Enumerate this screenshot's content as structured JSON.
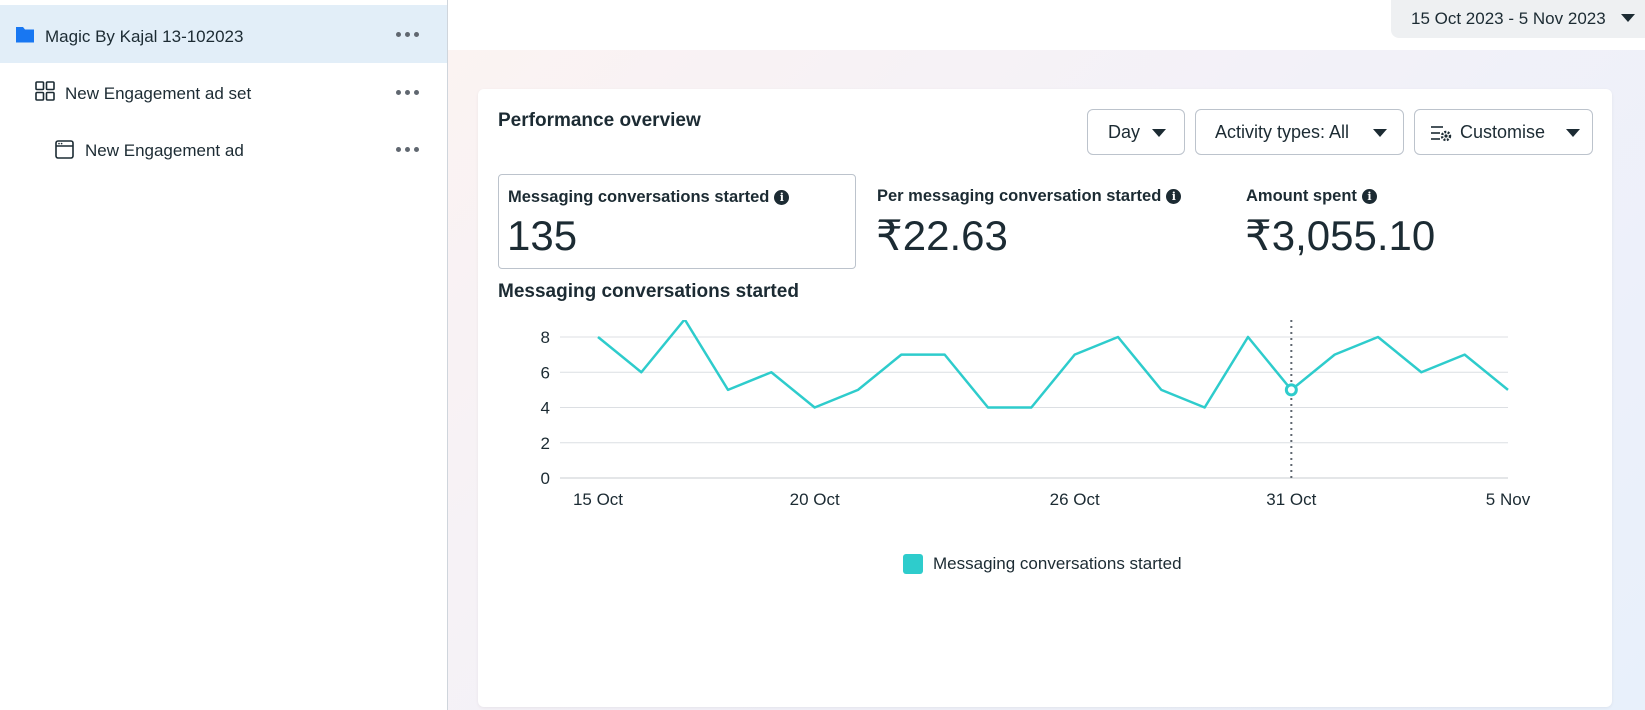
{
  "sidebar": {
    "items": [
      {
        "label": "Magic By Kajal 13-102023",
        "icon": "folder-icon",
        "selected": true
      },
      {
        "label": "New Engagement ad set",
        "icon": "grid-icon",
        "selected": false
      },
      {
        "label": "New Engagement ad",
        "icon": "ad-window-icon",
        "selected": false
      }
    ]
  },
  "header": {
    "date_range": "15 Oct 2023 - 5 Nov 2023"
  },
  "overview": {
    "title": "Performance overview",
    "buttons": {
      "day": "Day",
      "activity": "Activity types: All",
      "customise": "Customise"
    },
    "metrics": [
      {
        "label": "Messaging conversations started",
        "value": "135"
      },
      {
        "label": "Per messaging conversation started",
        "value": "₹22.63"
      },
      {
        "label": "Amount spent",
        "value": "₹3,055.10"
      }
    ]
  },
  "chart_title": "Messaging conversations started",
  "colors": {
    "series": "#2ecccc",
    "accent": "#1877f2",
    "selected_bg": "#e2eef8"
  },
  "chart_data": {
    "type": "line",
    "title": "Messaging conversations started",
    "xlabel": "",
    "ylabel": "",
    "x": [
      "15 Oct",
      "16 Oct",
      "17 Oct",
      "18 Oct",
      "19 Oct",
      "20 Oct",
      "21 Oct",
      "22 Oct",
      "23 Oct",
      "24 Oct",
      "25 Oct",
      "26 Oct",
      "27 Oct",
      "28 Oct",
      "29 Oct",
      "30 Oct",
      "31 Oct",
      "1 Nov",
      "2 Nov",
      "3 Nov",
      "4 Nov",
      "5 Nov"
    ],
    "x_ticks": [
      "15 Oct",
      "20 Oct",
      "26 Oct",
      "31 Oct",
      "5 Nov"
    ],
    "series": [
      {
        "name": "Messaging conversations started",
        "values": [
          8,
          6,
          9,
          5,
          6,
          4,
          5,
          7,
          7,
          4,
          4,
          7,
          8,
          5,
          4,
          8,
          5,
          7,
          8,
          6,
          7,
          5
        ]
      }
    ],
    "ylim": [
      0,
      8
    ],
    "y_ticks": [
      0,
      2,
      4,
      6,
      8
    ],
    "highlight": "31 Oct",
    "grid": true,
    "legend": "bottom-center"
  }
}
